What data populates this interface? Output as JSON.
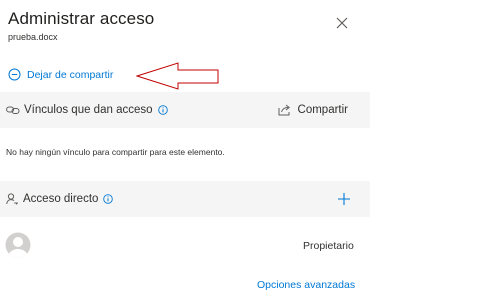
{
  "dialog": {
    "title": "Administrar acceso",
    "filename": "prueba.docx",
    "close_icon": "close-icon"
  },
  "stop_sharing": {
    "label": "Dejar de compartir",
    "icon": "circle-minus-icon"
  },
  "links_section": {
    "label": "Vínculos que dan acceso",
    "info_icon": "info-icon",
    "share_label": "Compartir",
    "share_icon": "share-icon",
    "empty_message": "No hay ningún vínculo para compartir para este elemento."
  },
  "direct_access": {
    "label": "Acceso directo",
    "info_icon": "info-icon",
    "add_icon": "plus-icon"
  },
  "owner": {
    "role": "Propietario",
    "avatar_icon": "person-avatar-icon"
  },
  "footer": {
    "advanced_label": "Opciones avanzadas"
  },
  "colors": {
    "accent": "#0078d4",
    "header_bg": "#f5f5f5",
    "annotation_arrow": "#c00000"
  }
}
